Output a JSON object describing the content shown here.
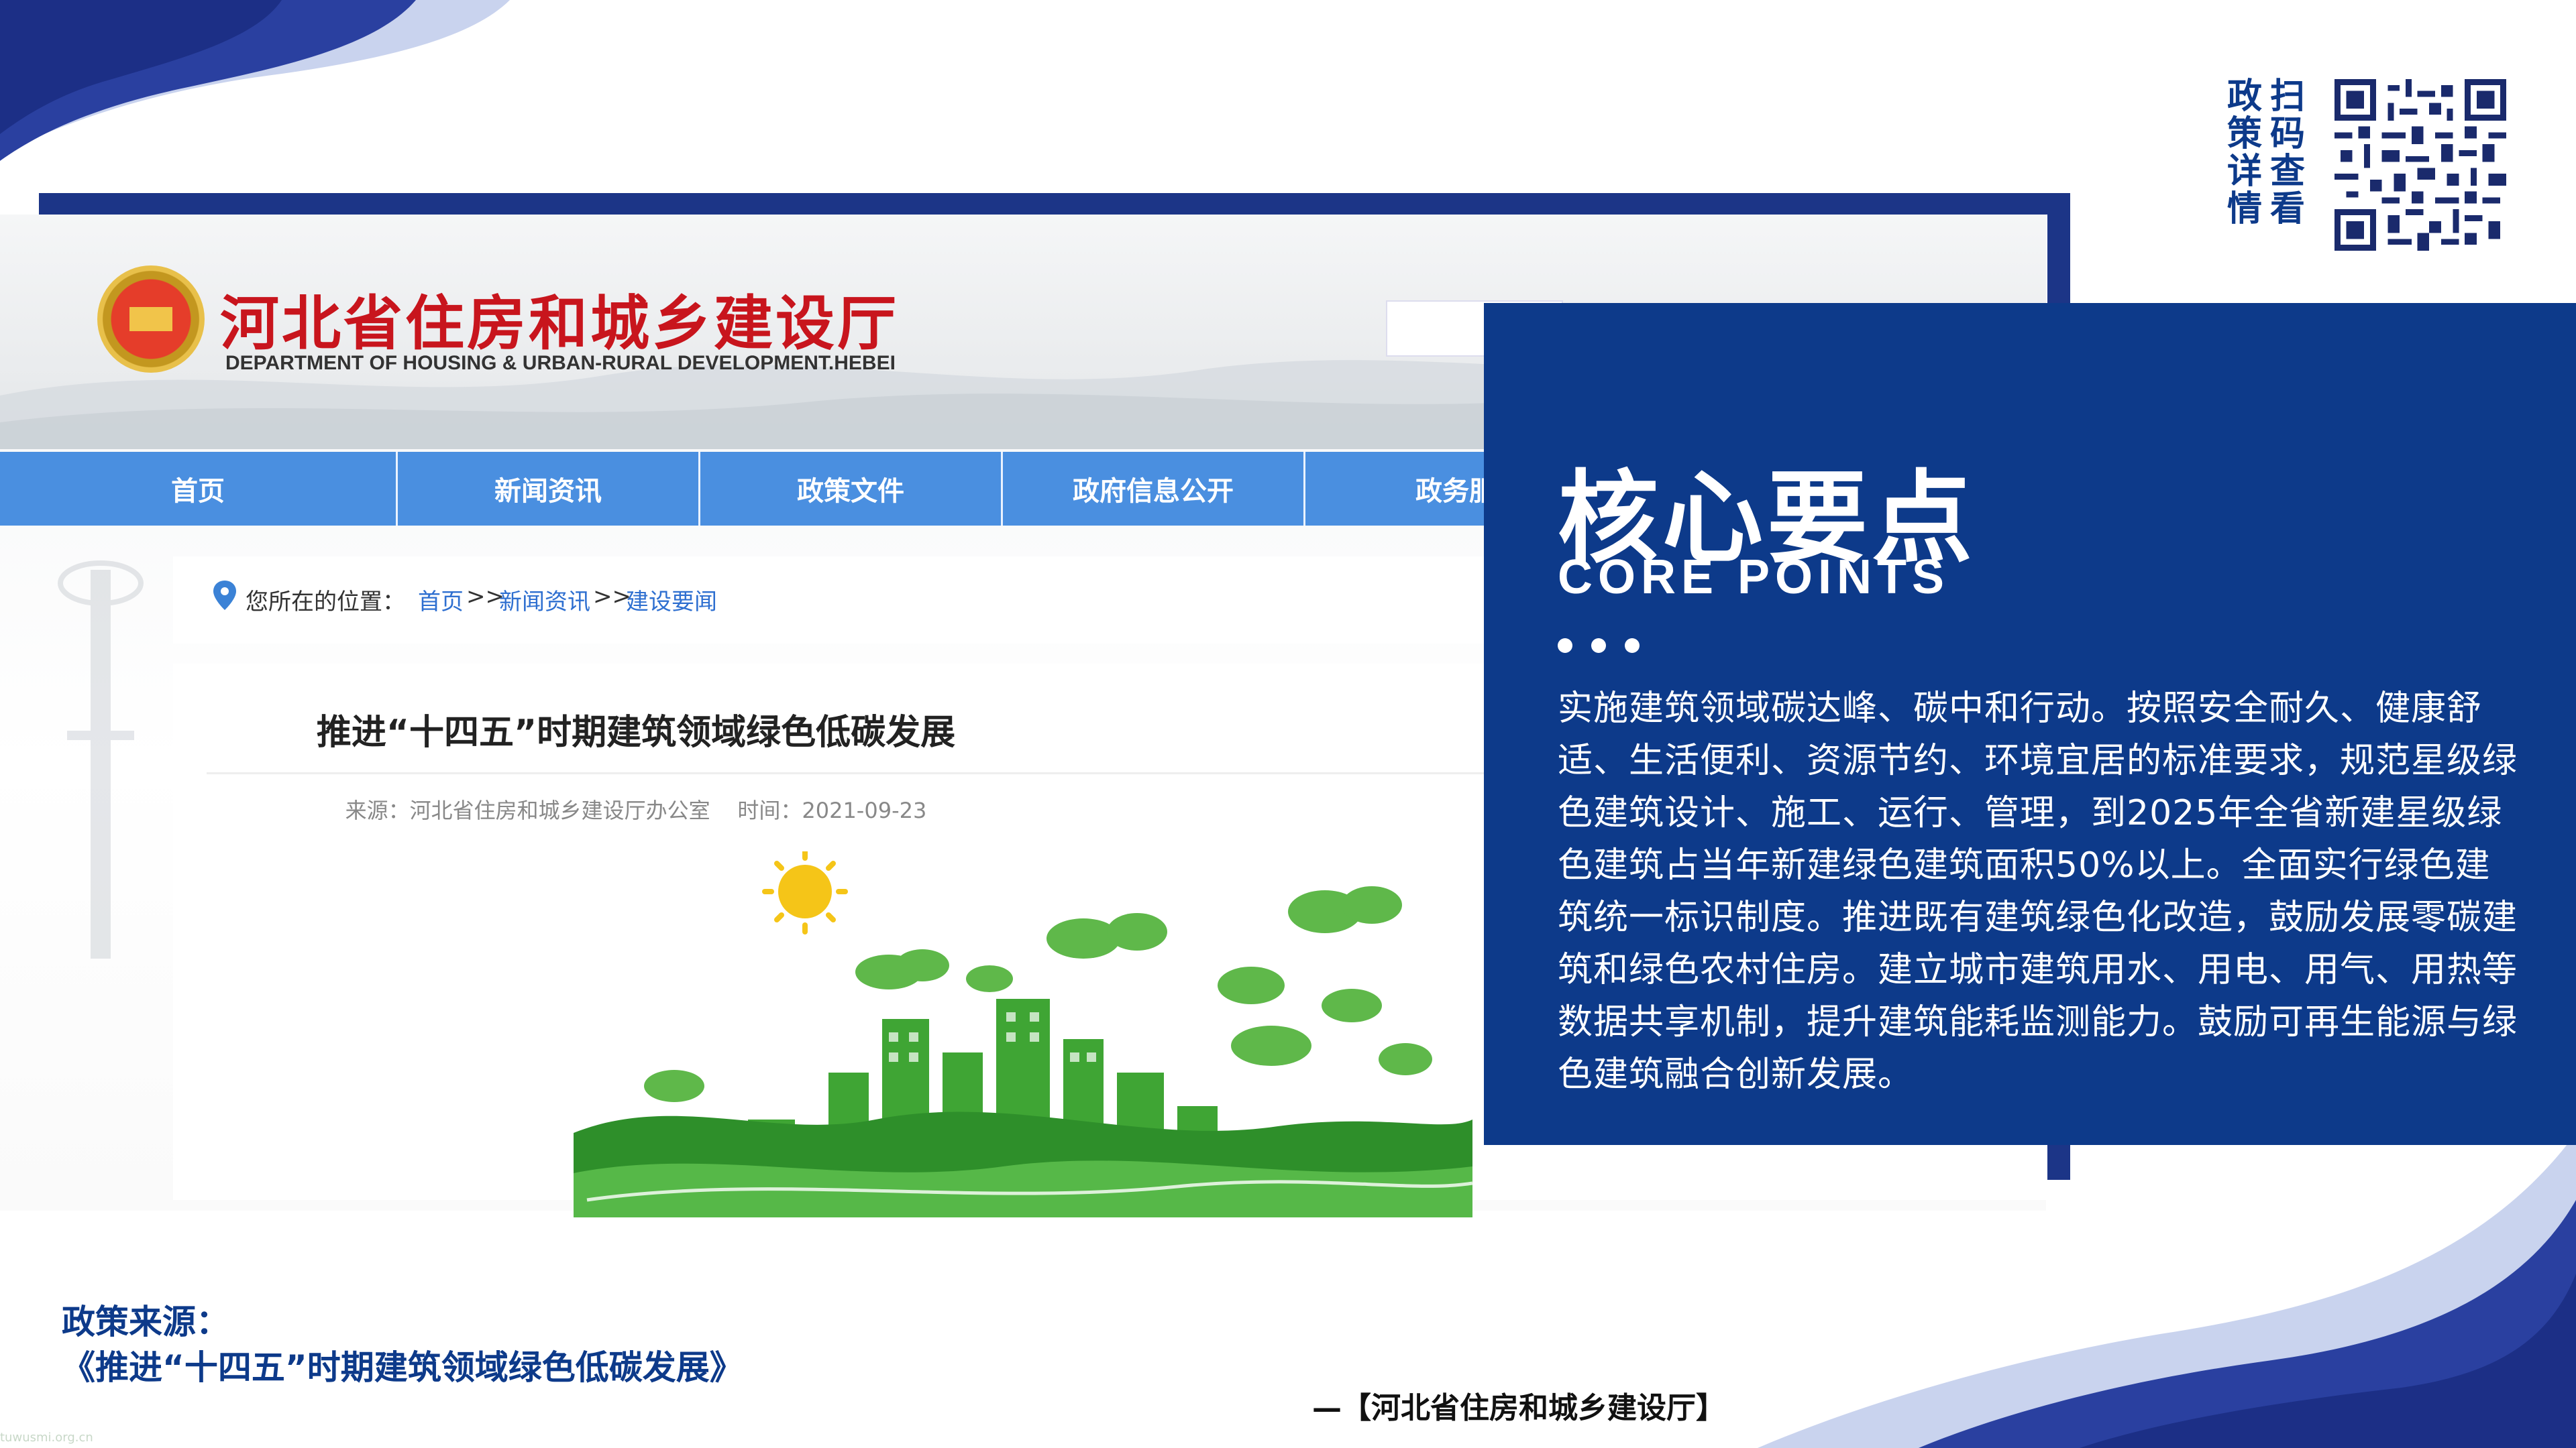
{
  "site": {
    "title_cn": "河北省住房和城乡建设厅",
    "title_en": "DEPARTMENT OF HOUSING & URBAN-RURAL DEVELOPMENT.HEBEI"
  },
  "nav": {
    "items": [
      {
        "label": "首页"
      },
      {
        "label": "新闻资讯"
      },
      {
        "label": "政策文件"
      },
      {
        "label": "政府信息公开"
      },
      {
        "label": "政务服"
      }
    ]
  },
  "breadcrumb": {
    "label": "您所在的位置：",
    "items": [
      {
        "label": "首页"
      },
      {
        "label": "新闻资讯"
      },
      {
        "label": "建设要闻"
      }
    ],
    "separator": ">>"
  },
  "article": {
    "title": "推进“十四五”时期建筑领域绿色低碳发展",
    "source": "来源：河北省住房和城乡建设厅办公室",
    "time": "时间：2021-09-23"
  },
  "core_points": {
    "title": "核心要点",
    "subtitle": "CORE POINTS",
    "body": "实施建筑领域碳达峰、碳中和行动。按照安全耐久、健康舒适、生活便利、资源节约、环境宜居的标准要求，规范星级绿色建筑设计、施工、运行、管理，到2025年全省新建星级绿色建筑占当年新建绿色建筑面积50%以上。全面实行绿色建筑统一标识制度。推进既有建筑绿色化改造，鼓励发展零碳建筑和绿色农村住房。建立城市建筑用水、用电、用气、用热等数据共享机制，提升建筑能耗监测能力。鼓励可再生能源与绿色建筑融合创新发展。"
  },
  "qr": {
    "col1": [
      "政",
      "策",
      "详",
      "情"
    ],
    "col2": [
      "扫",
      "码",
      "查",
      "看"
    ]
  },
  "footer": {
    "source_label": "政策来源：",
    "source_doc": "《推进“十四五”时期建筑领域绿色低碳发展》",
    "attribution": "—【河北省住房和城乡建设厅】",
    "watermark": "tuwusmi.org.cn"
  },
  "colors": {
    "brand_navy": "#0d3a8a",
    "nav_blue": "#4a8fe0",
    "site_red": "#c8151d",
    "link_blue": "#2e6fd0",
    "green": "#3fa534"
  },
  "icons": [
    "location-pin-icon",
    "sun-icon",
    "national-emblem-icon",
    "qr-code-icon"
  ]
}
